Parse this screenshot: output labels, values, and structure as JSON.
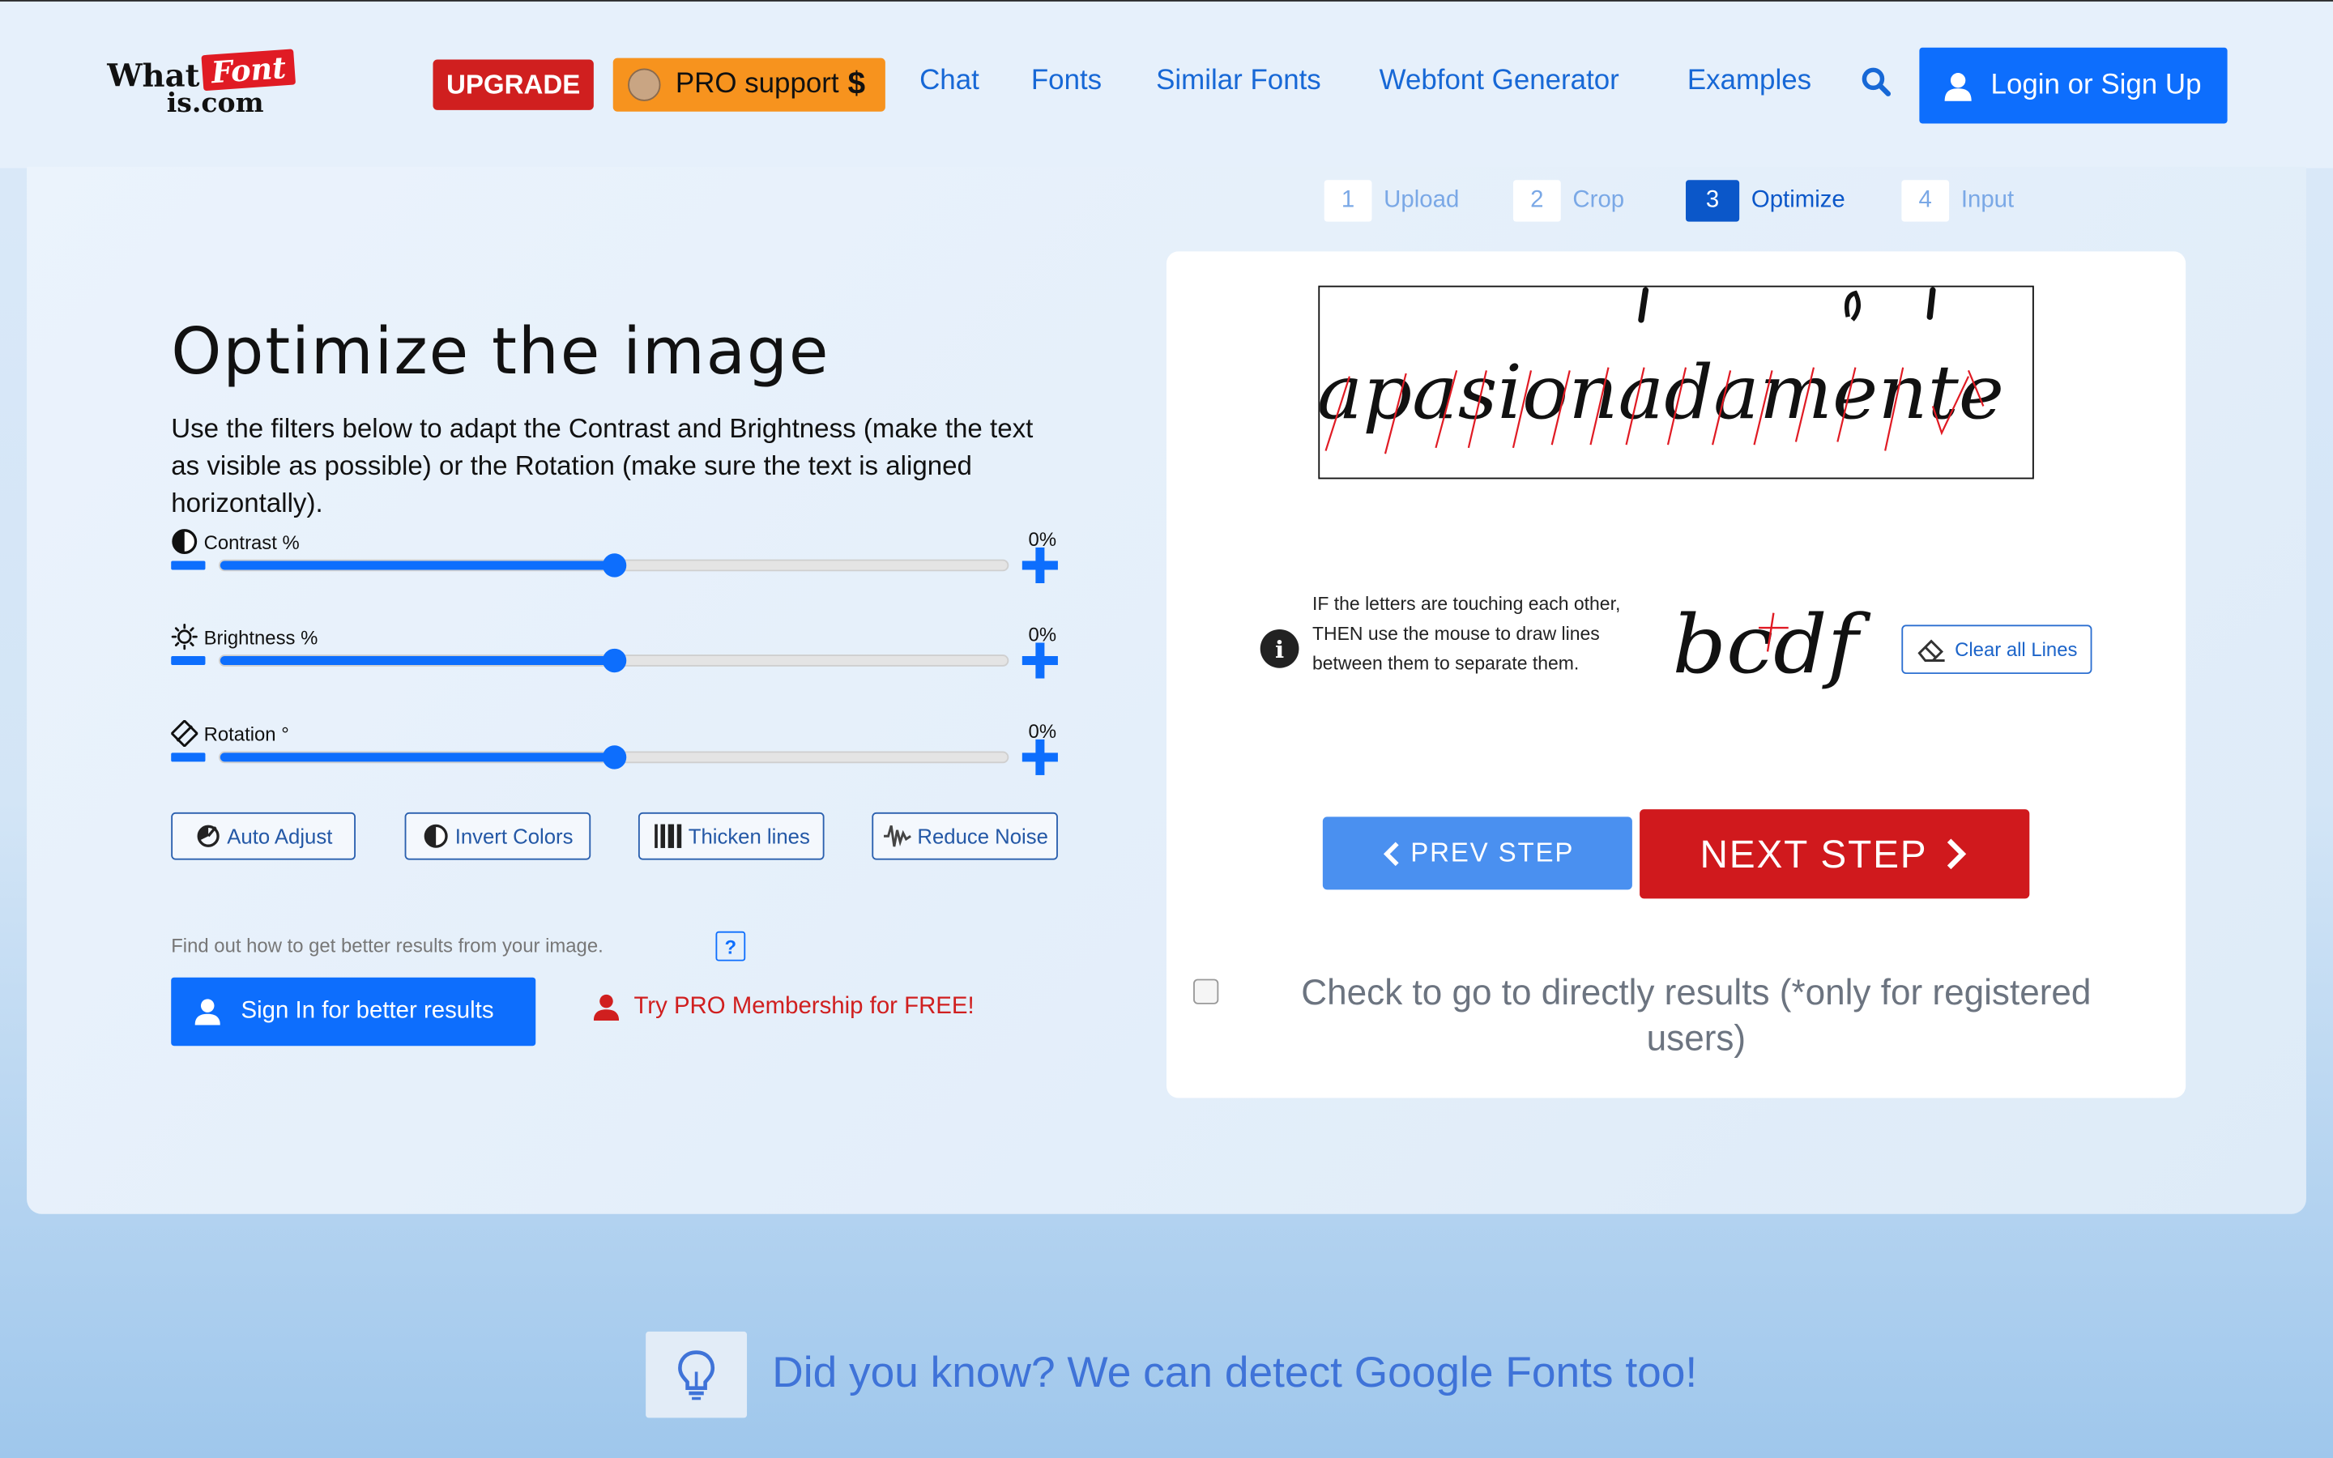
{
  "header": {
    "logo": {
      "what": "What",
      "font": "Font",
      "iscom": "is.com"
    },
    "upgrade_label": "UPGRADE",
    "pro_support_label": "PRO support",
    "pro_support_symbol": "$",
    "nav": [
      "Chat",
      "Fonts",
      "Similar Fonts",
      "Webfont Generator",
      "Examples"
    ],
    "login_label": "Login or Sign Up"
  },
  "steps": [
    {
      "num": "1",
      "label": "Upload",
      "active": false
    },
    {
      "num": "2",
      "label": "Crop",
      "active": false
    },
    {
      "num": "3",
      "label": "Optimize",
      "active": true
    },
    {
      "num": "4",
      "label": "Input",
      "active": false
    }
  ],
  "optimize": {
    "title": "Optimize the image",
    "description": {
      "p1": "Use the filters below to adapt the ",
      "b1": "Contrast",
      "p2": " and ",
      "b2": "Brightness",
      "p3": " (make the text as visible as possible) or the ",
      "b3": "Rotation",
      "p4": " (make sure the text is aligned horizontally)."
    },
    "sliders": [
      {
        "label": "Contrast %",
        "value_text": "0%",
        "position": 0.5
      },
      {
        "label": "Brightness %",
        "value_text": "0%",
        "position": 0.5
      },
      {
        "label": "Rotation °",
        "value_text": "0%",
        "position": 0.5
      }
    ],
    "tools": [
      "Auto Adjust",
      "Invert Colors",
      "Thicken lines",
      "Reduce Noise"
    ],
    "findout_text": "Find out how to get better results from your image.",
    "help_label": "?",
    "signin_label": "Sign In for better results",
    "trypro_label": "Try PRO Membership for FREE!"
  },
  "card": {
    "preview_text": "apasionadamente",
    "info_text": "IF the letters are touching each other, THEN use the mouse to draw lines between them to separate them.",
    "example_text": "bcdf",
    "clear_label": "Clear all Lines",
    "prev_label": "PREV STEP",
    "next_label": "NEXT STEP",
    "checkbox_checked": false,
    "checkbox_label": "Check to go to directly results (*only for registered users)"
  },
  "tip": {
    "text": "Did you know? We can detect Google Fonts too!"
  },
  "colors": {
    "primary": "#0d6efd",
    "upgrade": "#d01f1f",
    "pro": "#f7931e",
    "next": "#d0191d",
    "prev": "#4a90f0"
  }
}
